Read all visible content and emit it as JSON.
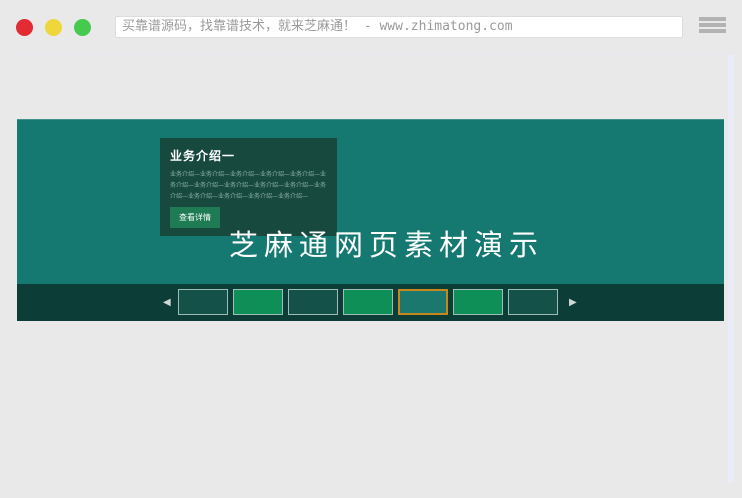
{
  "browser": {
    "traffic_lights": [
      {
        "name": "close",
        "color": "#e22b33"
      },
      {
        "name": "minimize",
        "color": "#efd63b"
      },
      {
        "name": "maximize",
        "color": "#46ca4d"
      }
    ],
    "address_bar": {
      "text": "买靠谱源码，找靠谱技术，就来芝麻通！ - www.zhimatong.com"
    },
    "menu_icon": "hamburger"
  },
  "banner": {
    "slide": {
      "card": {
        "title": "业务介绍一",
        "body": "业务介绍—业务介绍—业务介绍—业务介绍—业务介绍—业务介绍—业务介绍—业务介绍—业务介绍—业务介绍—业务介绍—业务介绍—业务介绍—业务介绍—业务介绍—",
        "button_label": "查看详情"
      },
      "headline": "芝麻通网页素材演示"
    },
    "carousel": {
      "prev_icon": "◀",
      "next_icon": "▶",
      "active_index": 4,
      "thumbs": [
        {
          "variant": "dark"
        },
        {
          "variant": "green"
        },
        {
          "variant": "dark"
        },
        {
          "variant": "green"
        },
        {
          "variant": "active"
        },
        {
          "variant": "green"
        },
        {
          "variant": "dark"
        }
      ]
    }
  },
  "colors": {
    "light_red": "#e22b33",
    "light_yellow": "#efd63b",
    "light_green": "#46ca4d",
    "banner_bg": "#157971",
    "card_bg": "#17493e",
    "card_text": "#8db1a6",
    "button_bg": "#1e7b54",
    "strip_bg": "#0c3e37",
    "thumb_dark": "#145148",
    "thumb_green": "#0e8f57",
    "thumb_active": "#1b786f",
    "thumb_active_border": "#c8871c",
    "thumb_border": "#9fbcb6"
  }
}
